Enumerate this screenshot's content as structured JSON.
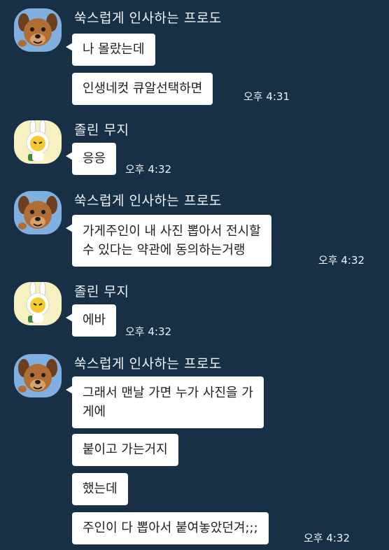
{
  "messages": [
    {
      "sender": "쑥스럽게 인사하는 프로도",
      "avatar_icon": "frodo-dog-icon",
      "bubbles": [
        {
          "text": "나 몰랐는데"
        },
        {
          "text": "인생네컷 큐알선택하면",
          "time": "오후 4:31"
        }
      ]
    },
    {
      "sender": "졸린 무지",
      "avatar_icon": "muzi-sleepy-icon",
      "bubbles": [
        {
          "text": "응응",
          "time": "오후 4:32"
        }
      ]
    },
    {
      "sender": "쑥스럽게 인사하는 프로도",
      "avatar_icon": "frodo-dog-icon",
      "bubbles": [
        {
          "line1": "가게주인이 내 사진 뽑아서 전시할",
          "line2": "수 있다는 약관에 동의하는거랭",
          "time": "오후 4:32"
        }
      ]
    },
    {
      "sender": "졸린 무지",
      "avatar_icon": "muzi-sleepy-icon",
      "bubbles": [
        {
          "text": "에바",
          "time": "오후 4:32"
        }
      ]
    },
    {
      "sender": "쑥스럽게 인사하는 프로도",
      "avatar_icon": "frodo-dog-icon",
      "bubbles": [
        {
          "line1": "그래서 맨날 가면 누가 사진을 가",
          "line2": "게에"
        },
        {
          "text": "붙이고 가는거지"
        },
        {
          "text": "했는데"
        },
        {
          "text": "주인이 다 뽑아서 붙여놓았던겨;;;",
          "time": "오후 4:32"
        }
      ]
    }
  ],
  "colors": {
    "background": "#173046",
    "bubble": "#ffffff",
    "frodo_avatar_bg": "#7fb0e0",
    "muzi_avatar_bg": "#f7f0c0"
  }
}
